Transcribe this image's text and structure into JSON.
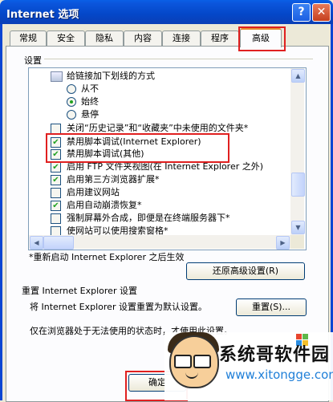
{
  "window": {
    "title": "Internet 选项",
    "help_glyph": "?",
    "close_glyph": "✕"
  },
  "tabs": [
    {
      "label": "常规"
    },
    {
      "label": "安全"
    },
    {
      "label": "隐私"
    },
    {
      "label": "内容"
    },
    {
      "label": "连接"
    },
    {
      "label": "程序"
    },
    {
      "label": "高级",
      "selected": true
    }
  ],
  "settings": {
    "group_label": "设置",
    "items": [
      {
        "type": "group",
        "label": "给链接加下划线的方式"
      },
      {
        "type": "radio",
        "label": "从不",
        "checked": false
      },
      {
        "type": "radio",
        "label": "始终",
        "checked": true
      },
      {
        "type": "radio",
        "label": "悬停",
        "checked": false
      },
      {
        "type": "checkbox",
        "label": "关闭“历史记录”和“收藏夹”中未使用的文件夹*",
        "checked": false
      },
      {
        "type": "checkbox",
        "label": "禁用脚本调试(Internet Explorer)",
        "checked": true
      },
      {
        "type": "checkbox",
        "label": "禁用脚本调试(其他)",
        "checked": true
      },
      {
        "type": "checkbox",
        "label": "启用 FTP 文件夹视图(在 Internet Explorer 之外)",
        "checked": true
      },
      {
        "type": "checkbox",
        "label": "启用第三方浏览器扩展*",
        "checked": true
      },
      {
        "type": "checkbox",
        "label": "启用建议网站",
        "checked": false
      },
      {
        "type": "checkbox",
        "label": "启用自动崩溃恢复*",
        "checked": true
      },
      {
        "type": "checkbox",
        "label": "强制屏幕外合成，即便是在终端服务器下*",
        "checked": false
      },
      {
        "type": "checkbox",
        "label": "使网站可以使用搜索窗格*",
        "checked": false
      }
    ],
    "check_glyph": "✔",
    "restart_note": "*重新启动 Internet Explorer 之后生效",
    "restore_button": "还原高级设置(R)"
  },
  "reset": {
    "heading": "重置 Internet Explorer 设置",
    "description": "将 Internet Explorer 设置重置为默认设置。",
    "button": "重置(S)...",
    "note": "仅在浏览器处于无法使用的状态时，才使用此设置。"
  },
  "footer": {
    "ok_button": "确定"
  },
  "watermark": {
    "brand_cn": "系统哥软件园",
    "url": "www.xitongge.com"
  },
  "colors": {
    "titlebar": "#0a46d2",
    "highlight": "#e02020",
    "check": "#21a121"
  }
}
